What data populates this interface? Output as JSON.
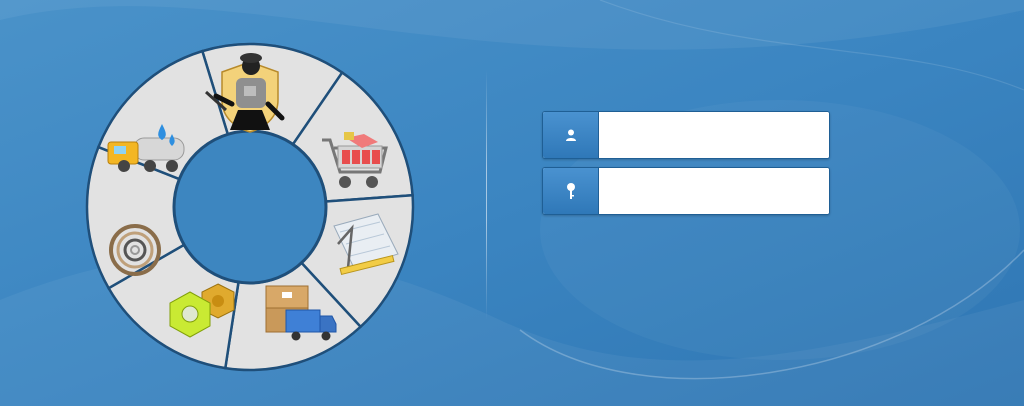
{
  "login": {
    "username": {
      "value": "",
      "placeholder": "",
      "icon": "user-icon"
    },
    "password": {
      "value": "",
      "placeholder": "",
      "icon": "key-icon"
    }
  },
  "wheel": {
    "segments": [
      {
        "name": "miner",
        "icon": "miner-worker-icon"
      },
      {
        "name": "shopping",
        "icon": "shopping-cart-icon"
      },
      {
        "name": "engineering",
        "icon": "blueprint-tools-icon"
      },
      {
        "name": "logistics",
        "icon": "delivery-truck-box-icon"
      },
      {
        "name": "hardware",
        "icon": "hex-nut-icon"
      },
      {
        "name": "rings",
        "icon": "metal-rings-icon"
      },
      {
        "name": "liquid-transport",
        "icon": "water-tanker-truck-icon"
      }
    ]
  },
  "colors": {
    "background": "#3d86c0",
    "accent": "#2f78b8",
    "segment": "#e2e2e2",
    "segment_border": "#1f4f7a"
  }
}
